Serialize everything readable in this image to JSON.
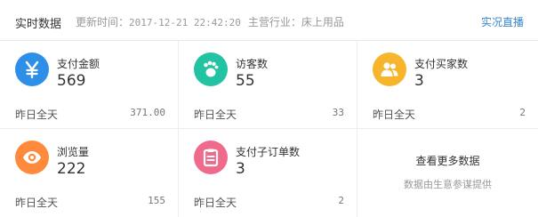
{
  "header": {
    "title": "实时数据",
    "update_label": "更新时间：",
    "update_time": "2017-12-21 22:42:20",
    "industry_label": "主营行业：",
    "industry": "床上用品",
    "live_link": "实况直播"
  },
  "colors": {
    "blue": "#2e8fe8",
    "teal": "#22c3a2",
    "yellow": "#f7b52c",
    "orange": "#ff8a3d",
    "pink": "#f06a8c",
    "link": "#3a86c8"
  },
  "metrics": [
    {
      "icon": "yuan-icon",
      "label": "支付金额",
      "value": "569",
      "foot_label": "昨日全天",
      "foot_value": "371.00"
    },
    {
      "icon": "footprint-icon",
      "label": "访客数",
      "value": "55",
      "foot_label": "昨日全天",
      "foot_value": "33"
    },
    {
      "icon": "buyers-icon",
      "label": "支付买家数",
      "value": "3",
      "foot_label": "昨日全天",
      "foot_value": "2"
    },
    {
      "icon": "eye-icon",
      "label": "浏览量",
      "value": "222",
      "foot_label": "昨日全天",
      "foot_value": "155"
    },
    {
      "icon": "order-icon",
      "label": "支付子订单数",
      "value": "3",
      "foot_label": "昨日全天",
      "foot_value": "2"
    }
  ],
  "more": {
    "title": "查看更多数据",
    "subtitle": "数据由生意参谋提供"
  }
}
